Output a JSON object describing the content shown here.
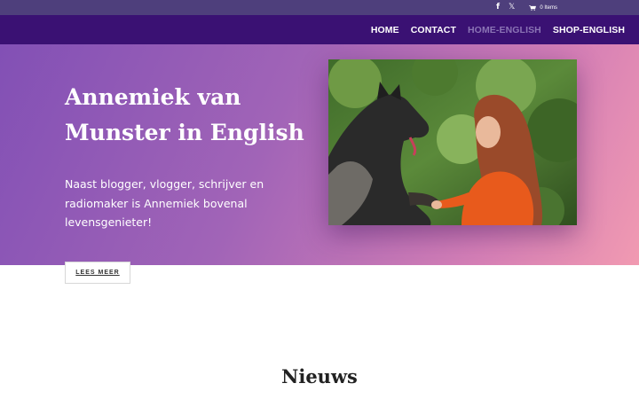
{
  "topbar": {
    "social": [
      {
        "icon": "facebook-icon",
        "glyph": "f"
      },
      {
        "icon": "x-twitter-icon",
        "glyph": "𝕏"
      }
    ],
    "cart_icon": "cart-icon",
    "cart_label": "0 Items"
  },
  "nav": {
    "items": [
      {
        "label": "HOME",
        "active": false
      },
      {
        "label": "CONTACT",
        "active": false
      },
      {
        "label": "HOME-ENGLISH",
        "active": true
      },
      {
        "label": "SHOP-ENGLISH",
        "active": false
      }
    ]
  },
  "hero": {
    "title": "Annemiek van Munster in English",
    "text": "Naast blogger, vlogger, schrijver en radiomaker is Annemiek bovenal levensgenieter!",
    "photo_icon": "woman-with-dog-photo",
    "button_label": "LEES MEER"
  },
  "news": {
    "heading": "Nieuws"
  },
  "colors": {
    "topbar": "#4e3f7c",
    "navbar": "#3a1173",
    "nav_active": "#8b74b5",
    "hero_gradient_start": "#8250b5",
    "hero_gradient_end": "#f19ab1"
  }
}
